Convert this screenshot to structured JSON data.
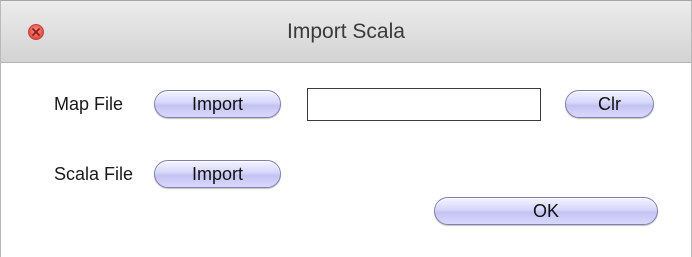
{
  "window": {
    "title": "Import Scala"
  },
  "map_file": {
    "label": "Map File",
    "import_label": "Import",
    "path_value": "",
    "clear_label": "Clr"
  },
  "scala_file": {
    "label": "Scala File",
    "import_label": "Import"
  },
  "ok_label": "OK"
}
